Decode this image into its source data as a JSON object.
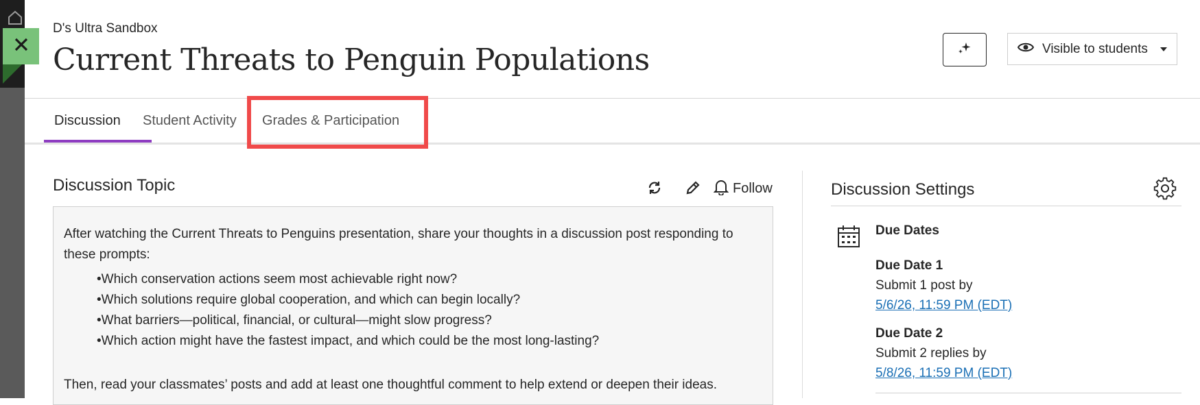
{
  "header": {
    "course_name": "D's Ultra Sandbox",
    "title": "Current Threats to Penguin Populations",
    "visibility_label": "Visible to students"
  },
  "tabs": [
    {
      "label": "Discussion",
      "active": true
    },
    {
      "label": "Student Activity",
      "active": false
    },
    {
      "label": "Grades & Participation",
      "active": false
    }
  ],
  "topic": {
    "heading": "Discussion Topic",
    "follow_label": "Follow",
    "intro": "After watching the Current Threats to Penguins presentation, share your thoughts in a discussion post responding to these prompts:",
    "bullets": [
      "Which conservation actions seem most achievable right now?",
      "Which solutions require global cooperation, and which can begin locally?",
      "What barriers—political, financial, or cultural—might slow progress?",
      "Which action might have the fastest impact, and which could be the most long-lasting?"
    ],
    "closing": "Then, read your classmates’ posts and add at least one thoughtful comment to help extend or deepen their ideas."
  },
  "settings": {
    "heading": "Discussion Settings",
    "due_dates_title": "Due Dates",
    "due_dates": [
      {
        "name": "Due Date 1",
        "requirement": "Submit 1 post by",
        "date": "5/6/26, 11:59 PM (EDT)"
      },
      {
        "name": "Due Date 2",
        "requirement": "Submit 2 replies by",
        "date": "5/8/26, 11:59 PM (EDT)"
      }
    ]
  },
  "colors": {
    "accent_tab": "#8e3dc1",
    "highlight": "#f04a4a",
    "close_button": "#79c27a",
    "link": "#1a6fb5"
  },
  "icons": [
    "home-icon",
    "close-icon",
    "ai-sparkle-icon",
    "eye-icon",
    "refresh-icon",
    "pencil-icon",
    "bell-icon",
    "gear-icon",
    "calendar-icon"
  ]
}
